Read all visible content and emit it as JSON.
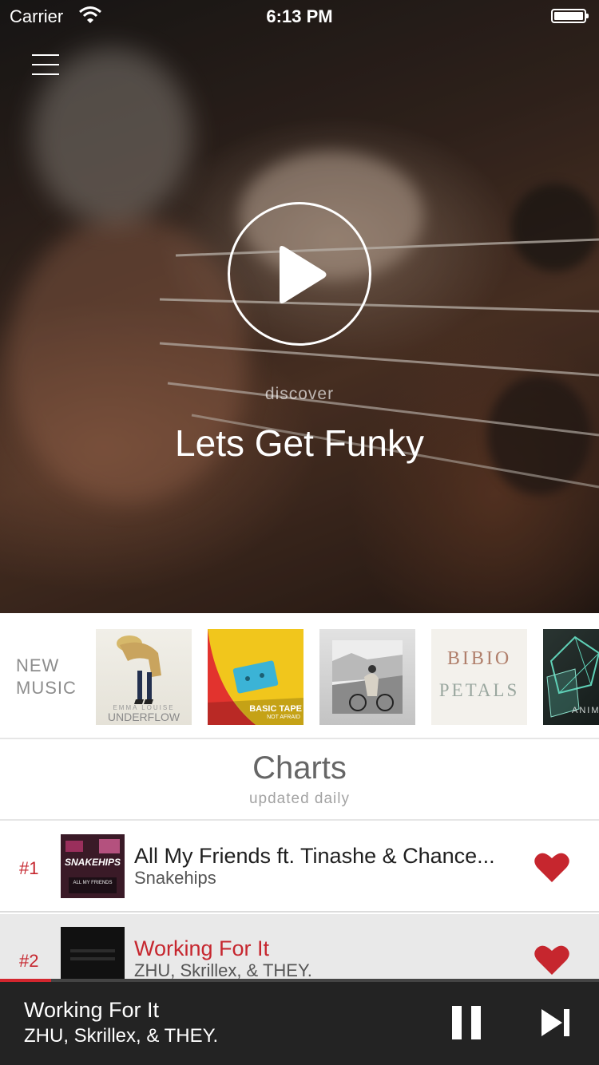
{
  "status_bar": {
    "carrier": "Carrier",
    "time": "6:13 PM"
  },
  "hero": {
    "kicker": "discover",
    "title": "Lets Get Funky"
  },
  "new_music": {
    "label_line1": "NEW",
    "label_line2": "MUSIC",
    "albums": [
      {
        "cover_line1": "EMMA LOUISE",
        "cover_line2": "UNDERFLOW"
      },
      {
        "cover_line1": "BASIC TAPE",
        "cover_line2": "NOT AFRAID"
      },
      {
        "cover_line1": "",
        "cover_line2": ""
      },
      {
        "cover_line1": "BIBIO",
        "cover_line2": "PETALS"
      },
      {
        "cover_line1": "ANIMA",
        "cover_line2": ""
      }
    ]
  },
  "charts": {
    "title": "Charts",
    "subtitle": "updated daily",
    "rows": [
      {
        "rank": "#1",
        "title": "All My Friends ft. Tinashe & Chance...",
        "artist": "Snakehips",
        "cover_text": "SNAKEHIPS",
        "cover_sub": "ALL MY FRIENDS",
        "favorited": true
      },
      {
        "rank": "#2",
        "title": "Working For It",
        "artist": "ZHU, Skrillex, & THEY.",
        "cover_text": "",
        "cover_sub": "",
        "favorited": true
      }
    ]
  },
  "now_playing": {
    "title": "Working For It",
    "artist": "ZHU, Skrillex, & THEY.",
    "progress": 0.085
  },
  "colors": {
    "accent": "#c6262e",
    "player_bg": "#232323"
  },
  "icons": {
    "menu": "hamburger-icon",
    "play": "play-icon",
    "heart": "heart-icon",
    "pause": "pause-icon",
    "next": "skip-next-icon"
  }
}
